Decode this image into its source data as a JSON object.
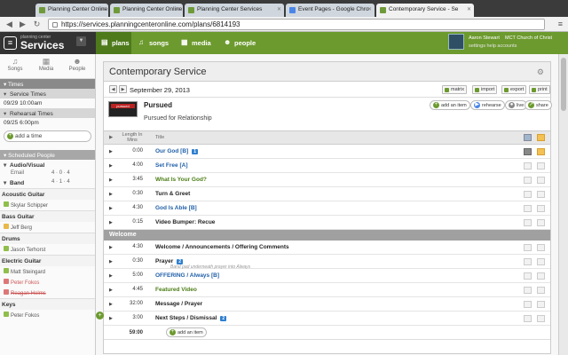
{
  "browser": {
    "tabs": [
      {
        "label": "Planning Center Online"
      },
      {
        "label": "Planning Center Online"
      },
      {
        "label": "Planning Center Services"
      },
      {
        "label": "Event Pages - Google Chro"
      },
      {
        "label": "Contemporary Service - Se"
      }
    ],
    "url": "https://services.planningcenteronline.com/plans/6814193"
  },
  "app": {
    "brand_small": "planning center",
    "brand": "Services",
    "modules": [
      {
        "label": "plans",
        "icon": "plans-icon"
      },
      {
        "label": "songs",
        "icon": "songs-icon"
      },
      {
        "label": "media",
        "icon": "media-icon"
      },
      {
        "label": "people",
        "icon": "people-icon"
      }
    ],
    "user": {
      "name": "Aaron Stewart",
      "church": "MCT Church of Christ",
      "links": "settings  help  accounts"
    }
  },
  "sidebar": {
    "icons": [
      {
        "label": "Songs",
        "icon": "songs-icon"
      },
      {
        "label": "Media",
        "icon": "media-icon"
      },
      {
        "label": "People",
        "icon": "people-icon"
      }
    ],
    "times_header": "Times",
    "service_times_label": "Service Times",
    "service_time": "09/29 10:00am",
    "rehearsal_times_label": "Rehearsal Times",
    "rehearsal_time": "09/25 6:00pm",
    "add_time": "add a time",
    "scheduled_header": "Scheduled People",
    "teams": [
      {
        "name": "Audio/Visual",
        "sub": "Email",
        "c1": "4",
        "c2": "0",
        "c3": "4"
      },
      {
        "name": "Band",
        "c1": "4",
        "c2": "1",
        "c3": "4"
      }
    ],
    "positions": [
      {
        "role": "Acoustic Guitar",
        "person": "Skylar Schipper",
        "status": "ok"
      },
      {
        "role": "Bass Guitar",
        "person": "Jeff Berg",
        "status": "warn"
      },
      {
        "role": "Drums",
        "person": "Jason Terhorst",
        "status": "ok"
      },
      {
        "role": "Electric Guitar",
        "person": "Matt Steingard",
        "status": "ok"
      },
      {
        "role": "",
        "person": "Peter Fokos",
        "status": "red",
        "strike": false
      },
      {
        "role": "",
        "person": "Reagan Helms",
        "status": "red",
        "strike": true
      },
      {
        "role": "Keys",
        "person": "Peter Fokos",
        "status": "ok"
      }
    ]
  },
  "plan": {
    "title": "Contemporary Service",
    "date": "September 29, 2013",
    "actions": [
      "matrix",
      "import",
      "export",
      "print"
    ],
    "item": {
      "title": "Pursued",
      "subtitle": "Pursued for Relationship",
      "thumb_label": "pursued",
      "buttons": [
        "add an item",
        "rehearse",
        "live",
        "share"
      ]
    },
    "columns": {
      "length": "Length In Mins",
      "title": "Title"
    },
    "rows": [
      {
        "len": "0:00",
        "title": "Our God [B]",
        "color": "blue",
        "badge": "1"
      },
      {
        "len": "4:00",
        "title": "Set Free [A]",
        "color": "blue"
      },
      {
        "len": "3:45",
        "title": "What Is Your God?",
        "color": "green"
      },
      {
        "len": "0:30",
        "title": "Turn & Greet",
        "color": "dark"
      },
      {
        "len": "4:30",
        "title": "God Is Able [B]",
        "color": "blue"
      },
      {
        "len": "0:15",
        "title": "Video Bumper: Recue",
        "color": "dark"
      }
    ],
    "section": "Welcome",
    "rows2": [
      {
        "len": "4:30",
        "title": "Welcome / Announcements / Offering Comments",
        "color": "dark"
      },
      {
        "len": "0:30",
        "title": "Prayer",
        "color": "dark",
        "badge": "2",
        "note": "Band pad underneath prayer into Always"
      },
      {
        "len": "5:00",
        "title": "OFFERING / Always [B]",
        "color": "blue"
      },
      {
        "len": "4:45",
        "title": "Featured Video",
        "color": "green"
      },
      {
        "len": "32:00",
        "title": "Message / Prayer",
        "color": "dark"
      },
      {
        "len": "3:00",
        "title": "Next Steps / Dismissal",
        "color": "dark",
        "badge": "2"
      }
    ],
    "total": "59:00",
    "add_item": "add an item"
  }
}
